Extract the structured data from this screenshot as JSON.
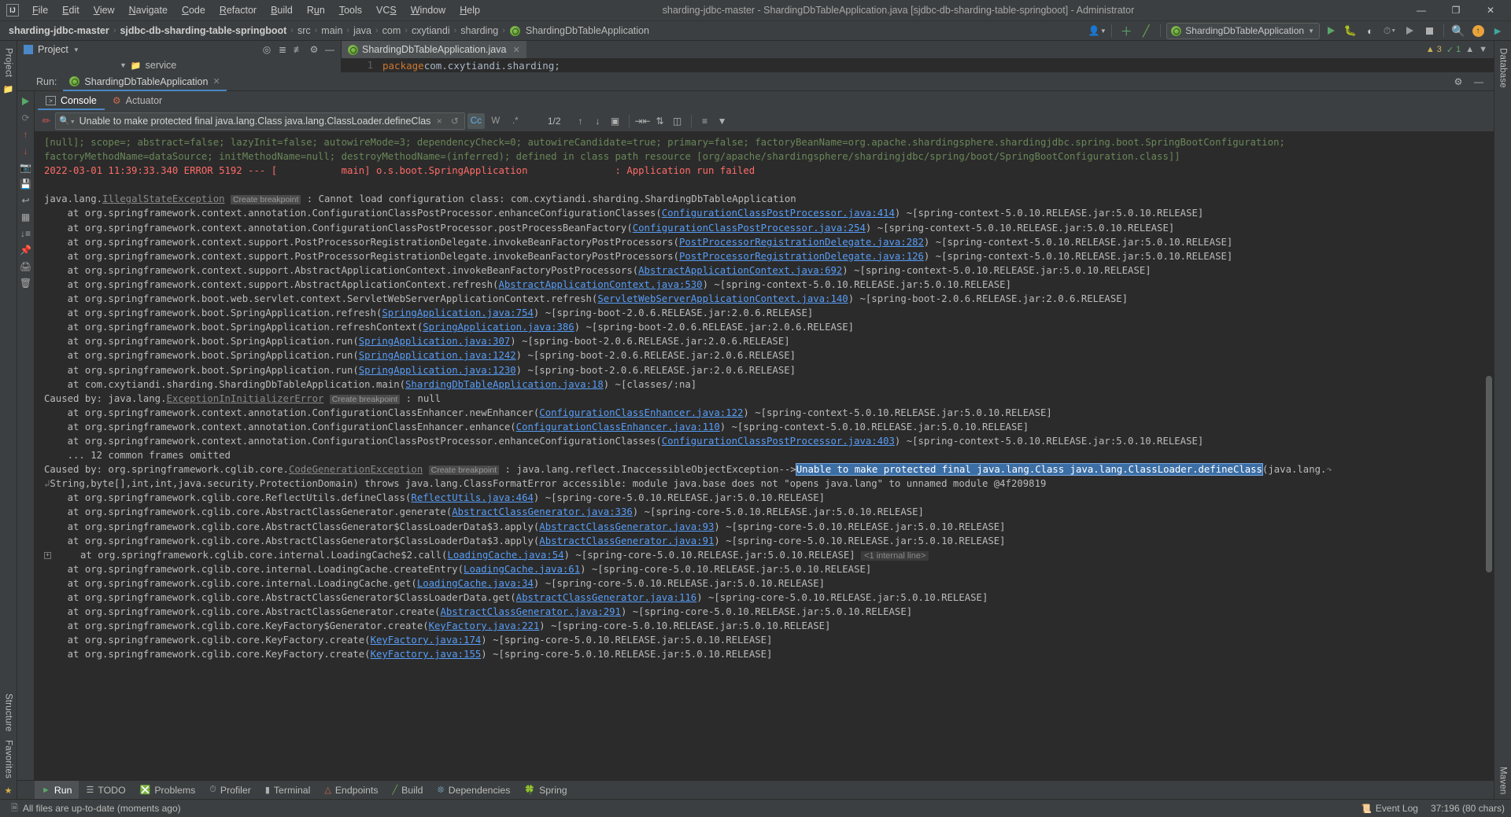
{
  "titlebar": {
    "logo": "IJ",
    "menus": [
      "File",
      "Edit",
      "View",
      "Navigate",
      "Code",
      "Refactor",
      "Build",
      "Run",
      "Tools",
      "VCS",
      "Window",
      "Help"
    ],
    "window_title": "sharding-jdbc-master - ShardingDbTableApplication.java [sjdbc-db-sharding-table-springboot] - Administrator",
    "minimize": "—",
    "maximize": "❐",
    "close": "✕"
  },
  "navbar": {
    "crumbs": [
      "sharding-jdbc-master",
      "sjdbc-db-sharding-table-springboot",
      "src",
      "main",
      "java",
      "com",
      "cxytiandi",
      "sharding",
      "ShardingDbTableApplication"
    ],
    "separator": "›",
    "run_config": "ShardingDbTableApplication",
    "icons": {
      "user": "user-icon",
      "add": "add-config-icon",
      "hammer": "build-icon",
      "run": "run-icon",
      "debug": "debug-icon",
      "coverage": "run-with-coverage-icon",
      "profiler": "profiler-icon",
      "attach": "attach-icon",
      "stop": "stop-icon",
      "search": "search-everywhere-icon",
      "update": "update-icon",
      "ide": "ide-icon"
    }
  },
  "project_panel": {
    "title": "Project",
    "tree_node": "service",
    "icons": [
      "locate-icon",
      "expand-all-icon",
      "collapse-all-icon",
      "settings-gear-icon",
      "hide-icon"
    ]
  },
  "editor": {
    "tab_label": "ShardingDbTableApplication.java",
    "line_number": "1",
    "code_keyword": "package",
    "code_rest": " com.cxytiandi.sharding;",
    "warnings": "3",
    "errors_ok": "1"
  },
  "run_window": {
    "label": "Run:",
    "tab": "ShardingDbTableApplication",
    "close_glyph": "×",
    "settings_glyph": "⚙",
    "hide_glyph": "—",
    "sidebar_icons": [
      "rerun-icon",
      "rerun-failed-icon",
      "scroll-up-icon",
      "scroll-down-icon",
      "camera-icon",
      "print-icon",
      "export-icon",
      "soft-wrap-icon",
      "pin-icon",
      "trash-icon"
    ]
  },
  "subtabs": [
    {
      "label": "Console",
      "icon": "console-icon",
      "active": true
    },
    {
      "label": "Actuator",
      "icon": "actuator-icon",
      "active": false
    }
  ],
  "search": {
    "query": "Unable to make protected final java.lang.Class java.lang.ClassLoader.defineClass",
    "placeholder": "Search",
    "clear": "×",
    "history": "↺",
    "toggle_case": "Cc",
    "toggle_words": "W",
    "toggle_regex": ".*",
    "match_count": "1/2",
    "prev": "↑",
    "next": "↓",
    "select_all": "▣",
    "filter_icons": [
      "wrap-icon",
      "scroll-icon",
      "compare-icon",
      "print2-icon",
      "filter-icon"
    ]
  },
  "console_lines": [
    {
      "type": "green",
      "text": "[null]; scope=; abstract=false; lazyInit=false; autowireMode=3; dependencyCheck=0; autowireCandidate=true; primary=false; factoryBeanName=org.apache.shardingsphere.shardingjdbc.spring.boot.SpringBootConfiguration;"
    },
    {
      "type": "green",
      "text": "factoryMethodName=dataSource; initMethodName=null; destroyMethodName=(inferred); defined in class path resource [org/apache/shardingsphere/shardingjdbc/spring/boot/SpringBootConfiguration.class]]"
    },
    {
      "type": "error",
      "text": "2022-03-01 11:39:33.340 ERROR 5192 --- [           main] o.s.boot.SpringApplication               : Application run failed"
    },
    {
      "type": "blank",
      "text": ""
    },
    {
      "type": "exception_head",
      "indent": 0,
      "prefix": "java.lang.",
      "link": "IllegalStateException",
      "hint": "Create breakpoint",
      "suffix": " : Cannot load configuration class: com.cxytiandi.sharding.ShardingDbTableApplication"
    },
    {
      "type": "frame",
      "prefix": "    at org.springframework.context.annotation.ConfigurationClassPostProcessor.enhanceConfigurationClasses(",
      "link": "ConfigurationClassPostProcessor.java:414",
      "suffix": ") ~[spring-context-5.0.10.RELEASE.jar:5.0.10.RELEASE]"
    },
    {
      "type": "frame",
      "prefix": "    at org.springframework.context.annotation.ConfigurationClassPostProcessor.postProcessBeanFactory(",
      "link": "ConfigurationClassPostProcessor.java:254",
      "suffix": ") ~[spring-context-5.0.10.RELEASE.jar:5.0.10.RELEASE]"
    },
    {
      "type": "frame",
      "prefix": "    at org.springframework.context.support.PostProcessorRegistrationDelegate.invokeBeanFactoryPostProcessors(",
      "link": "PostProcessorRegistrationDelegate.java:282",
      "suffix": ") ~[spring-context-5.0.10.RELEASE.jar:5.0.10.RELEASE]"
    },
    {
      "type": "frame",
      "prefix": "    at org.springframework.context.support.PostProcessorRegistrationDelegate.invokeBeanFactoryPostProcessors(",
      "link": "PostProcessorRegistrationDelegate.java:126",
      "suffix": ") ~[spring-context-5.0.10.RELEASE.jar:5.0.10.RELEASE]"
    },
    {
      "type": "frame",
      "prefix": "    at org.springframework.context.support.AbstractApplicationContext.invokeBeanFactoryPostProcessors(",
      "link": "AbstractApplicationContext.java:692",
      "suffix": ") ~[spring-context-5.0.10.RELEASE.jar:5.0.10.RELEASE]"
    },
    {
      "type": "frame",
      "prefix": "    at org.springframework.context.support.AbstractApplicationContext.refresh(",
      "link": "AbstractApplicationContext.java:530",
      "suffix": ") ~[spring-context-5.0.10.RELEASE.jar:5.0.10.RELEASE]"
    },
    {
      "type": "frame",
      "prefix": "    at org.springframework.boot.web.servlet.context.ServletWebServerApplicationContext.refresh(",
      "link": "ServletWebServerApplicationContext.java:140",
      "suffix": ") ~[spring-boot-2.0.6.RELEASE.jar:2.0.6.RELEASE]"
    },
    {
      "type": "frame",
      "prefix": "    at org.springframework.boot.SpringApplication.refresh(",
      "link": "SpringApplication.java:754",
      "suffix": ") ~[spring-boot-2.0.6.RELEASE.jar:2.0.6.RELEASE]"
    },
    {
      "type": "frame",
      "prefix": "    at org.springframework.boot.SpringApplication.refreshContext(",
      "link": "SpringApplication.java:386",
      "suffix": ") ~[spring-boot-2.0.6.RELEASE.jar:2.0.6.RELEASE]"
    },
    {
      "type": "frame",
      "prefix": "    at org.springframework.boot.SpringApplication.run(",
      "link": "SpringApplication.java:307",
      "suffix": ") ~[spring-boot-2.0.6.RELEASE.jar:2.0.6.RELEASE]"
    },
    {
      "type": "frame",
      "prefix": "    at org.springframework.boot.SpringApplication.run(",
      "link": "SpringApplication.java:1242",
      "suffix": ") ~[spring-boot-2.0.6.RELEASE.jar:2.0.6.RELEASE]"
    },
    {
      "type": "frame",
      "prefix": "    at org.springframework.boot.SpringApplication.run(",
      "link": "SpringApplication.java:1230",
      "suffix": ") ~[spring-boot-2.0.6.RELEASE.jar:2.0.6.RELEASE]"
    },
    {
      "type": "frame",
      "prefix": "    at com.cxytiandi.sharding.ShardingDbTableApplication.main(",
      "link": "ShardingDbTableApplication.java:18",
      "suffix": ") ~[classes/:na]"
    },
    {
      "type": "exception_head",
      "prefix": "Caused by: java.lang.",
      "link": "ExceptionInInitializerError",
      "hint": "Create breakpoint",
      "suffix": " : null"
    },
    {
      "type": "frame",
      "prefix": "    at org.springframework.context.annotation.ConfigurationClassEnhancer.newEnhancer(",
      "link": "ConfigurationClassEnhancer.java:122",
      "suffix": ") ~[spring-context-5.0.10.RELEASE.jar:5.0.10.RELEASE]"
    },
    {
      "type": "frame",
      "prefix": "    at org.springframework.context.annotation.ConfigurationClassEnhancer.enhance(",
      "link": "ConfigurationClassEnhancer.java:110",
      "suffix": ") ~[spring-context-5.0.10.RELEASE.jar:5.0.10.RELEASE]"
    },
    {
      "type": "frame",
      "prefix": "    at org.springframework.context.annotation.ConfigurationClassPostProcessor.enhanceConfigurationClasses(",
      "link": "ConfigurationClassPostProcessor.java:403",
      "suffix": ") ~[spring-context-5.0.10.RELEASE.jar:5.0.10.RELEASE]"
    },
    {
      "type": "plain",
      "text": "    ... 12 common frames omitted"
    },
    {
      "type": "caused_highlight",
      "prefix": "Caused by: org.springframework.cglib.core.",
      "link": "CodeGenerationException",
      "hint": "Create breakpoint",
      "mid": " : java.lang.reflect.InaccessibleObjectException-->",
      "match": "Unable to make protected final java.lang.Class java.lang.ClassLoader.defineClass",
      "tail": "(java.lang."
    },
    {
      "type": "wrapped",
      "text": "↳String,byte[],int,int,java.security.ProtectionDomain) throws java.lang.ClassFormatError accessible: module java.base does not \"opens java.lang\" to unnamed module @4f209819"
    },
    {
      "type": "frame",
      "prefix": "    at org.springframework.cglib.core.ReflectUtils.defineClass(",
      "link": "ReflectUtils.java:464",
      "suffix": ") ~[spring-core-5.0.10.RELEASE.jar:5.0.10.RELEASE]"
    },
    {
      "type": "frame",
      "prefix": "    at org.springframework.cglib.core.AbstractClassGenerator.generate(",
      "link": "AbstractClassGenerator.java:336",
      "suffix": ") ~[spring-core-5.0.10.RELEASE.jar:5.0.10.RELEASE]"
    },
    {
      "type": "frame",
      "prefix": "    at org.springframework.cglib.core.AbstractClassGenerator$ClassLoaderData$3.apply(",
      "link": "AbstractClassGenerator.java:93",
      "suffix": ") ~[spring-core-5.0.10.RELEASE.jar:5.0.10.RELEASE]"
    },
    {
      "type": "frame",
      "prefix": "    at org.springframework.cglib.core.AbstractClassGenerator$ClassLoaderData$3.apply(",
      "link": "AbstractClassGenerator.java:91",
      "suffix": ") ~[spring-core-5.0.10.RELEASE.jar:5.0.10.RELEASE]"
    },
    {
      "type": "frame_fold",
      "prefix": "    at org.springframework.cglib.core.internal.LoadingCache$2.call(",
      "link": "LoadingCache.java:54",
      "suffix": ") ~[spring-core-5.0.10.RELEASE.jar:5.0.10.RELEASE]",
      "inline_hint": "<1 internal line>"
    },
    {
      "type": "frame",
      "prefix": "    at org.springframework.cglib.core.internal.LoadingCache.createEntry(",
      "link": "LoadingCache.java:61",
      "suffix": ") ~[spring-core-5.0.10.RELEASE.jar:5.0.10.RELEASE]"
    },
    {
      "type": "frame",
      "prefix": "    at org.springframework.cglib.core.internal.LoadingCache.get(",
      "link": "LoadingCache.java:34",
      "suffix": ") ~[spring-core-5.0.10.RELEASE.jar:5.0.10.RELEASE]"
    },
    {
      "type": "frame",
      "prefix": "    at org.springframework.cglib.core.AbstractClassGenerator$ClassLoaderData.get(",
      "link": "AbstractClassGenerator.java:116",
      "suffix": ") ~[spring-core-5.0.10.RELEASE.jar:5.0.10.RELEASE]"
    },
    {
      "type": "frame",
      "prefix": "    at org.springframework.cglib.core.AbstractClassGenerator.create(",
      "link": "AbstractClassGenerator.java:291",
      "suffix": ") ~[spring-core-5.0.10.RELEASE.jar:5.0.10.RELEASE]"
    },
    {
      "type": "frame",
      "prefix": "    at org.springframework.cglib.core.KeyFactory$Generator.create(",
      "link": "KeyFactory.java:221",
      "suffix": ") ~[spring-core-5.0.10.RELEASE.jar:5.0.10.RELEASE]"
    },
    {
      "type": "frame",
      "prefix": "    at org.springframework.cglib.core.KeyFactory.create(",
      "link": "KeyFactory.java:174",
      "suffix": ") ~[spring-core-5.0.10.RELEASE.jar:5.0.10.RELEASE]"
    },
    {
      "type": "frame",
      "prefix": "    at org.springframework.cglib.core.KeyFactory.create(",
      "link": "KeyFactory.java:155",
      "suffix": ") ~[spring-core-5.0.10.RELEASE.jar:5.0.10.RELEASE]"
    }
  ],
  "bottom_tabs": [
    {
      "label": "Run",
      "icon": "run-icon",
      "active": true
    },
    {
      "label": "TODO",
      "icon": "todo-icon",
      "active": false
    },
    {
      "label": "Problems",
      "icon": "problems-icon",
      "active": false
    },
    {
      "label": "Profiler",
      "icon": "profiler-icon",
      "active": false
    },
    {
      "label": "Terminal",
      "icon": "terminal-icon",
      "active": false
    },
    {
      "label": "Endpoints",
      "icon": "endpoints-icon",
      "active": false
    },
    {
      "label": "Build",
      "icon": "build-hammer-icon",
      "active": false
    },
    {
      "label": "Dependencies",
      "icon": "dependencies-icon",
      "active": false
    },
    {
      "label": "Spring",
      "icon": "spring-leaf-icon",
      "active": false
    }
  ],
  "statusbar": {
    "message": "All files are up-to-date (moments ago)",
    "event_log": "Event Log",
    "caret_info": "37:196 (80 chars)"
  },
  "rails": {
    "left": [
      "Project",
      "Structure",
      "Favorites"
    ],
    "right": [
      "Database",
      "Maven"
    ]
  },
  "colors": {
    "bg_chrome": "#3c3f41",
    "bg_console": "#2b2b2b",
    "accent_blue": "#4a88c7",
    "log_green": "#6a8759",
    "log_error": "#ff6b68",
    "link": "#589df6",
    "selection": "#3b6ea5"
  }
}
